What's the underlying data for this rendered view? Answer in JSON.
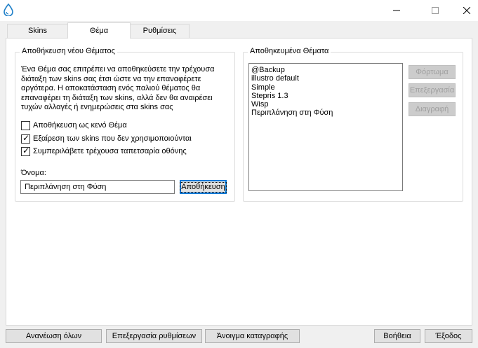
{
  "tabs": [
    {
      "label": "Skins",
      "active": false
    },
    {
      "label": "Θέμα",
      "active": true
    },
    {
      "label": "Ρυθμίσεις",
      "active": false
    }
  ],
  "save_group": {
    "title": "Αποθήκευση νέου Θέματος",
    "description": [
      "Ένα Θέμα σας επιτρέπει να αποθηκεύσετε την τρέχουσα",
      "διάταξη των skins σας έτσι ώστε να την επαναφέρετε",
      "αργότερα. Η αποκατάσταση ενός παλιού θέματος θα",
      "επαναφέρει τη διάταξη των skins, αλλά δεν θα αναιρέσει",
      "τυχών αλλαγές ή ενημερώσεις στα skins σας"
    ],
    "checkboxes": [
      {
        "label": "Αποθήκευση ως κενό Θέμα",
        "checked": false
      },
      {
        "label": "Εξαίρεση των skins που δεν χρησιμοποιούνται",
        "checked": true
      },
      {
        "label": "Συμπεριλάβετε τρέχουσα ταπετσαρία οθόνης",
        "checked": true
      }
    ],
    "name_label": "Όνομα:",
    "name_value": "Περιπλάνηση στη Φύση",
    "save_button": "Αποθήκευση"
  },
  "saved_group": {
    "title": "Αποθηκευμένα Θέματα",
    "items": [
      "@Backup",
      "illustro default",
      "Simple",
      "Stepris 1.3",
      "Wisp",
      "Περιπλάνηση στη Φύση"
    ],
    "load_button": "Φόρτωμα",
    "edit_button": "Επεξεργασία",
    "delete_button": "Διαγραφή"
  },
  "footer": {
    "refresh_all": "Ανανέωση όλων",
    "edit_settings": "Επεξεργασία ρυθμίσεων",
    "open_log": "Άνοιγμα καταγραφής",
    "help": "Βοήθεια",
    "exit": "Έξοδος"
  },
  "colors": {
    "default_button_border": "#0078d7",
    "app_icon": "#1e7fc8"
  }
}
